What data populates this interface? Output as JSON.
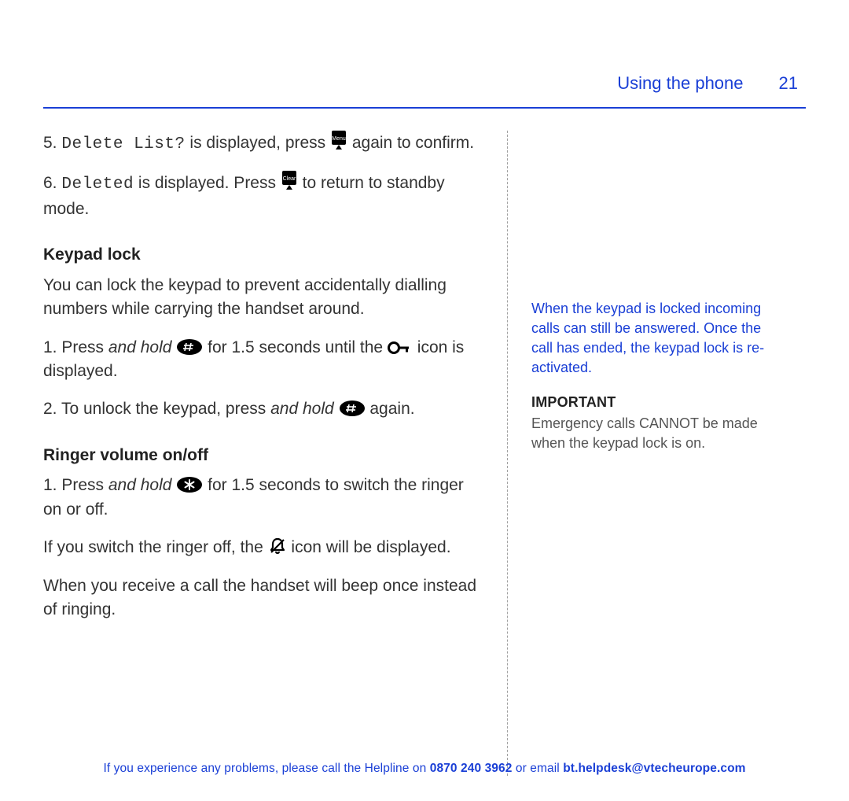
{
  "header": {
    "section_title": "Using the phone",
    "page_number": "21"
  },
  "main": {
    "step5": {
      "num": "5.",
      "lcd": "Delete List?",
      "t1": " is displayed, press ",
      "t2": " again to confirm."
    },
    "step6": {
      "num": "6.",
      "lcd": "Deleted",
      "t1": " is displayed. Press ",
      "t2": " to return to standby mode."
    },
    "keypad_lock": {
      "heading": "Keypad lock",
      "intro": "You can lock the keypad to prevent accidentally dialling numbers while carrying the handset around.",
      "s1": {
        "num": "1.",
        "t0": " Press ",
        "hold": "and hold",
        "t1": " ",
        "t2": " for 1.5 seconds until the ",
        "t3": " icon is displayed."
      },
      "s2": {
        "num": "2.",
        "t0": " To unlock the keypad, press ",
        "hold": "and hold",
        "t1": " ",
        "t2": " again."
      }
    },
    "ringer": {
      "heading": "Ringer volume on/off",
      "s1": {
        "num": "1.",
        "t0": " Press ",
        "hold": "and hold",
        "t1": " ",
        "t2": " for 1.5 seconds to switch the ringer on or off."
      },
      "p2a": "If you switch the ringer off, the ",
      "p2b": " icon will be displayed.",
      "p3": "When you receive a call the handset will beep once instead of ringing."
    }
  },
  "side": {
    "note": "When the keypad is locked incoming calls can still be answered. Once the call has ended, the keypad lock is re-activated.",
    "important_label": "IMPORTANT",
    "important_body": "Emergency calls CANNOT be made when the keypad lock is on."
  },
  "footer": {
    "t1": "If you experience any problems, please call the Helpline on ",
    "phone": "0870 240 3962",
    "t2": " or email ",
    "email": "bt.helpdesk@vtecheurope.com"
  },
  "icons": {
    "menu_label": "Menu",
    "clear_label": "Clear"
  }
}
